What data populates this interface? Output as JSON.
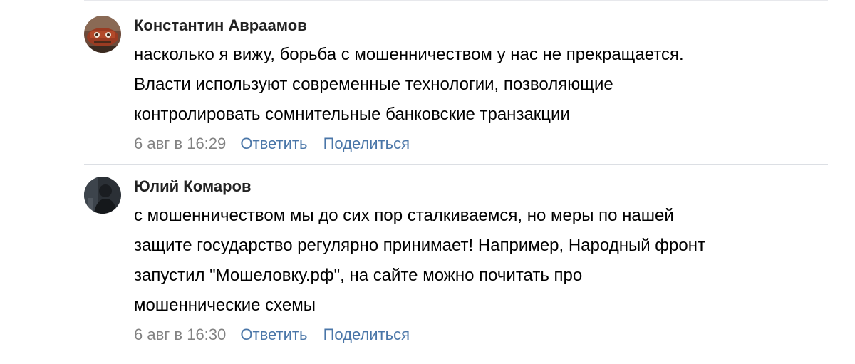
{
  "comments": [
    {
      "author": "Константин Авраамов",
      "lines": [
        "насколько я вижу, борьба с мошенничеством у нас не прекращается.",
        "Власти используют современные технологии, позволяющие",
        "контролировать сомнительные банковские транзакции"
      ],
      "date": "6 авг в 16:29",
      "reply_label": "Ответить",
      "share_label": "Поделиться",
      "avatar_icon": "car-avatar"
    },
    {
      "author": "Юлий Комаров",
      "lines": [
        "с мошенничеством мы до сих пор сталкиваемся, но меры по нашей",
        "защите государство регулярно принимает! Например, Народный фронт",
        "запустил \"Мошеловку.рф\", на сайте можно почитать про",
        "мошеннические схемы"
      ],
      "date": "6 авг в 16:30",
      "reply_label": "Ответить",
      "share_label": "Поделиться",
      "avatar_icon": "person-avatar"
    }
  ],
  "colors": {
    "link": "#4a76a8",
    "meta": "#828282",
    "divider": "#dcdfe4"
  }
}
